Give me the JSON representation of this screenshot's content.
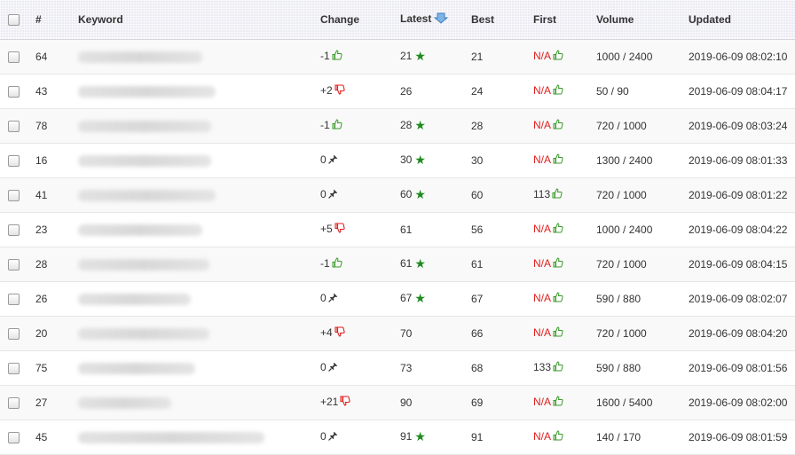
{
  "table": {
    "headers": {
      "num": "#",
      "keyword": "Keyword",
      "change": "Change",
      "latest": "Latest",
      "best": "Best",
      "first": "First",
      "volume": "Volume",
      "updated": "Updated"
    },
    "sorted_column": "latest",
    "rows": [
      {
        "num": "64",
        "change": "-1",
        "change_icon": "thumbs-up-icon",
        "latest": "21",
        "star": true,
        "best": "21",
        "first": "N/A",
        "first_na": true,
        "volume": "1000 / 2400",
        "updated": "2019-06-09 08:02:10"
      },
      {
        "num": "43",
        "change": "+2",
        "change_icon": "thumbs-down-icon",
        "latest": "26",
        "star": false,
        "best": "24",
        "first": "N/A",
        "first_na": true,
        "volume": "50 / 90",
        "updated": "2019-06-09 08:04:17"
      },
      {
        "num": "78",
        "change": "-1",
        "change_icon": "thumbs-up-icon",
        "latest": "28",
        "star": true,
        "best": "28",
        "first": "N/A",
        "first_na": true,
        "volume": "720 / 1000",
        "updated": "2019-06-09 08:03:24"
      },
      {
        "num": "16",
        "change": "0",
        "change_icon": "pin-icon",
        "latest": "30",
        "star": true,
        "best": "30",
        "first": "N/A",
        "first_na": true,
        "volume": "1300 / 2400",
        "updated": "2019-06-09 08:01:33"
      },
      {
        "num": "41",
        "change": "0",
        "change_icon": "pin-icon",
        "latest": "60",
        "star": true,
        "best": "60",
        "first": "113",
        "first_na": false,
        "volume": "720 / 1000",
        "updated": "2019-06-09 08:01:22"
      },
      {
        "num": "23",
        "change": "+5",
        "change_icon": "thumbs-down-icon",
        "latest": "61",
        "star": false,
        "best": "56",
        "first": "N/A",
        "first_na": true,
        "volume": "1000 / 2400",
        "updated": "2019-06-09 08:04:22"
      },
      {
        "num": "28",
        "change": "-1",
        "change_icon": "thumbs-up-icon",
        "latest": "61",
        "star": true,
        "best": "61",
        "first": "N/A",
        "first_na": true,
        "volume": "720 / 1000",
        "updated": "2019-06-09 08:04:15"
      },
      {
        "num": "26",
        "change": "0",
        "change_icon": "pin-icon",
        "latest": "67",
        "star": true,
        "best": "67",
        "first": "N/A",
        "first_na": true,
        "volume": "590 / 880",
        "updated": "2019-06-09 08:02:07"
      },
      {
        "num": "20",
        "change": "+4",
        "change_icon": "thumbs-down-icon",
        "latest": "70",
        "star": false,
        "best": "66",
        "first": "N/A",
        "first_na": true,
        "volume": "720 / 1000",
        "updated": "2019-06-09 08:04:20"
      },
      {
        "num": "75",
        "change": "0",
        "change_icon": "pin-icon",
        "latest": "73",
        "star": false,
        "best": "68",
        "first": "133",
        "first_na": false,
        "volume": "590 / 880",
        "updated": "2019-06-09 08:01:56"
      },
      {
        "num": "27",
        "change": "+21",
        "change_icon": "thumbs-down-icon",
        "latest": "90",
        "star": false,
        "best": "69",
        "first": "N/A",
        "first_na": true,
        "volume": "1600 / 5400",
        "updated": "2019-06-09 08:02:00"
      },
      {
        "num": "45",
        "change": "0",
        "change_icon": "pin-icon",
        "latest": "91",
        "star": true,
        "best": "91",
        "first": "N/A",
        "first_na": true,
        "volume": "140 / 170",
        "updated": "2019-06-09 08:01:59"
      }
    ]
  },
  "colors": {
    "up": "#3a9a2a",
    "down": "#e02020",
    "na": "#e01e1e",
    "star": "#1f8a1f",
    "sort_arrow": "#5b9bd5"
  }
}
